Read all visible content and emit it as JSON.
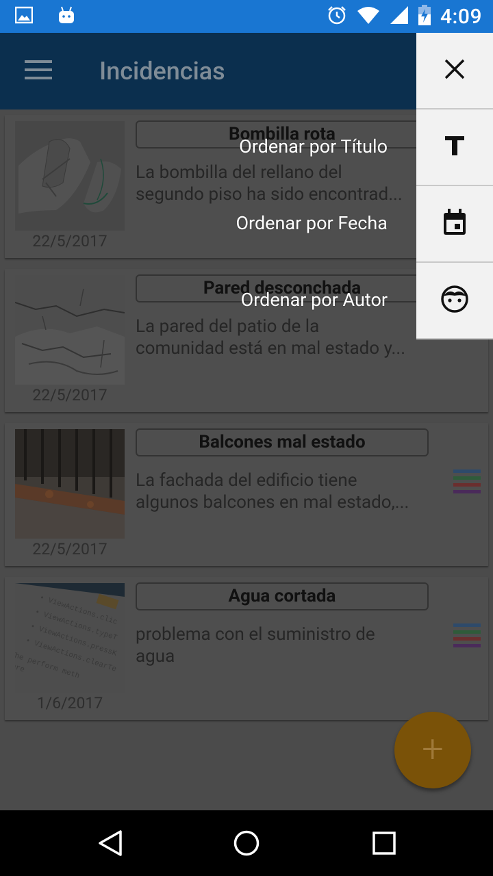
{
  "status_bar": {
    "time": "4:09",
    "color": "#1976d2"
  },
  "app_bar": {
    "title": "Incidencias",
    "menu_icon": "hamburger-menu-icon"
  },
  "incidents": [
    {
      "title": "Bombilla rota",
      "desc_line1": "La bombilla del rellano del",
      "desc_line2": "segundo piso ha sido encontrad...",
      "date": "22/5/2017"
    },
    {
      "title": "Pared desconchada",
      "desc_line1": "La pared del patio de la",
      "desc_line2": "comunidad está en mal estado y...",
      "date": "22/5/2017"
    },
    {
      "title": "Balcones mal estado",
      "desc_line1": "La fachada del edificio tiene",
      "desc_line2": "algunos balcones en mal estado,...",
      "date": "22/5/2017"
    },
    {
      "title": "Agua cortada",
      "desc_line1": "problema con el suministro de",
      "desc_line2": "agua",
      "date": "1/6/2017"
    }
  ],
  "sort_menu": {
    "close_icon": "close-icon",
    "items": [
      {
        "label": "Ordenar por Título",
        "icon": "title-text-icon"
      },
      {
        "label": "Ordenar por Fecha",
        "icon": "calendar-icon"
      },
      {
        "label": "Ordenar por Autor",
        "icon": "face-icon"
      }
    ]
  },
  "fab": {
    "label": "+",
    "icon": "add-icon"
  },
  "nav_bar": {
    "back": "back-icon",
    "home": "home-icon",
    "recents": "recents-icon"
  },
  "colors": {
    "primary": "#0b2f4e",
    "accent": "#7a5208",
    "status": "#1976d2"
  }
}
